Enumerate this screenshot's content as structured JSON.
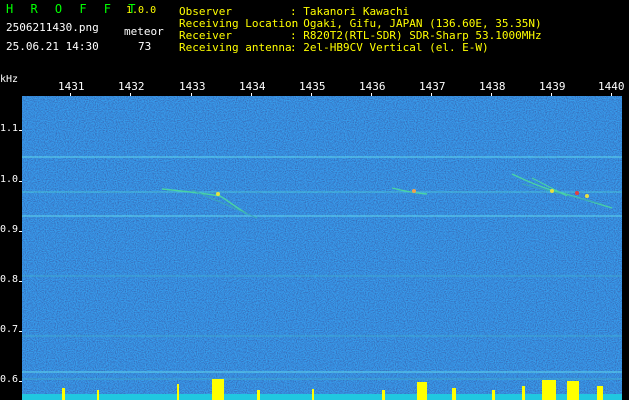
{
  "header": {
    "brand": "H R O F F T",
    "version": "1.0.0",
    "filename": "2506211430.png",
    "datetime": "25.06.21 14:30",
    "meteor_label": "meteor",
    "meteor_count": "73",
    "info": [
      {
        "label": "Observer",
        "value": ": Takanori Kawachi"
      },
      {
        "label": "Receiving Location",
        "value": ": Ogaki, Gifu, JAPAN (136.60E, 35.35N)"
      },
      {
        "label": "Receiver",
        "value": ": R820T2(RTL-SDR) SDR-Sharp 53.1000MHz"
      },
      {
        "label": "Receiving antenna",
        "value": ": 2el-HB9CV Vertical (el. E-W)"
      }
    ]
  },
  "axes": {
    "y_unit": "kHz",
    "x_ticks": [
      "1431",
      "1432",
      "1433",
      "1434",
      "1435",
      "1436",
      "1437",
      "1438",
      "1439",
      "1440"
    ],
    "y_ticks": [
      "1.1",
      "1.0",
      "0.9",
      "0.8",
      "0.7",
      "0.6"
    ]
  },
  "colors": {
    "background": "#000000",
    "spectrum": "#0a1a78",
    "brand": "#00ff00",
    "accent": "#ffff00"
  }
}
